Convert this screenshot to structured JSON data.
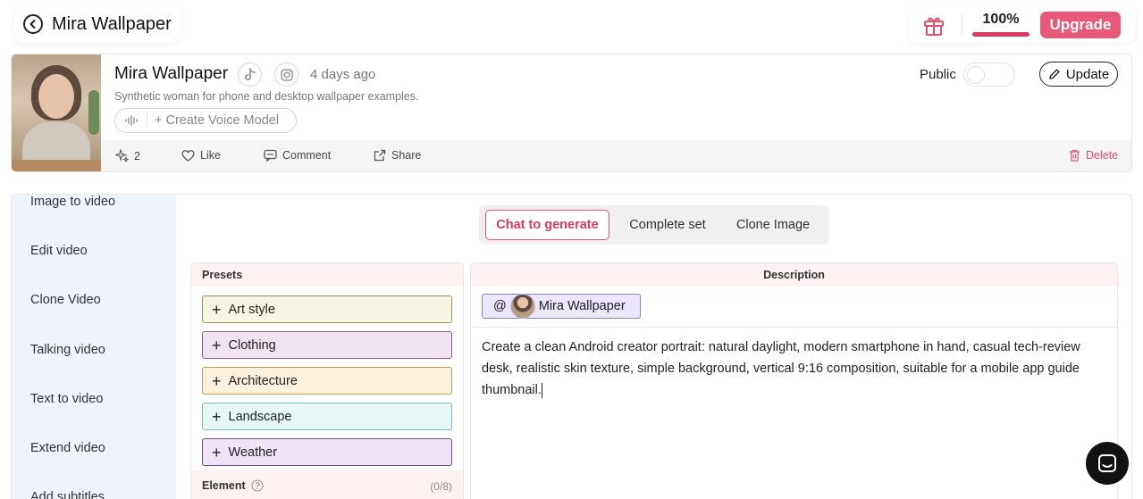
{
  "header": {
    "title": "Mira Wallpaper",
    "credits_percent": "100%",
    "credits_fraction": 1.0,
    "upgrade_label": "Upgrade"
  },
  "profile": {
    "name": "Mira Wallpaper",
    "time_ago": "4 days ago",
    "description": "Synthetic woman for phone and desktop wallpaper examples.",
    "create_voice_label": "+ Create Voice Model",
    "public_label": "Public",
    "update_label": "Update",
    "actions": {
      "sparkle_count": "2",
      "like": "Like",
      "comment": "Comment",
      "share": "Share",
      "delete": "Delete"
    }
  },
  "sidebar": {
    "items": [
      {
        "label": "Image to video"
      },
      {
        "label": "Edit video"
      },
      {
        "label": "Clone Video"
      },
      {
        "label": "Talking video"
      },
      {
        "label": "Text to video"
      },
      {
        "label": "Extend video"
      },
      {
        "label": "Add subtitles"
      }
    ]
  },
  "tabs": [
    {
      "label": "Chat to generate",
      "active": true
    },
    {
      "label": "Complete set",
      "active": false
    },
    {
      "label": "Clone Image",
      "active": false
    }
  ],
  "presets": {
    "title": "Presets",
    "items": [
      {
        "label": "Art style",
        "bg": "#f6f4e3",
        "border": "#9a9458"
      },
      {
        "label": "Clothing",
        "bg": "#f0e3f0",
        "border": "#8a5a8a"
      },
      {
        "label": "Architecture",
        "bg": "#fdf0de",
        "border": "#c79a55"
      },
      {
        "label": "Landscape",
        "bg": "#e6f7f5",
        "border": "#7bbdb6"
      },
      {
        "label": "Weather",
        "bg": "#efe3f6",
        "border": "#6d4a8a"
      }
    ],
    "element_label": "Element",
    "element_count": "(0/8)"
  },
  "description": {
    "title": "Description",
    "mention_prefix": "@",
    "mention_name": "Mira Wallpaper",
    "prompt": "Create a clean Android creator portrait: natural daylight, modern smartphone in hand, casual tech-review desk, realistic skin texture, simple background, vertical 9:16 composition, suitable for a mobile app guide thumbnail."
  },
  "colors": {
    "accent": "#e8587a",
    "sidebar_bg": "#eef3fc",
    "header_tint": "#fdf1f1"
  }
}
